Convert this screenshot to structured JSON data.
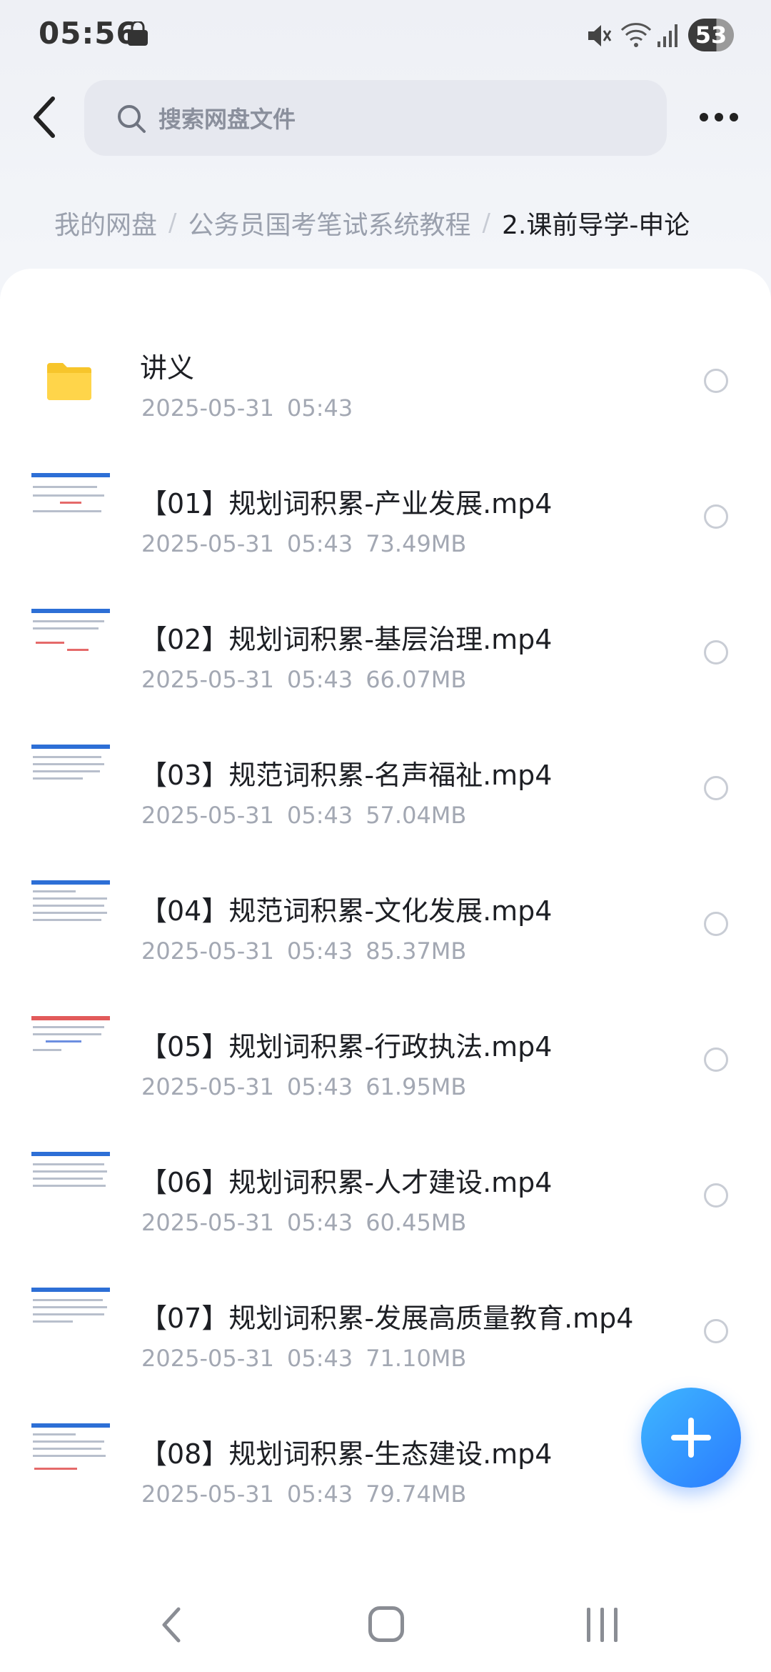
{
  "status_bar": {
    "time": "05:56",
    "battery": "53",
    "icons": [
      "shopping-bag-icon",
      "mute-icon",
      "wifi-icon",
      "signal-icon"
    ]
  },
  "search": {
    "placeholder": "搜索网盘文件"
  },
  "breadcrumb": {
    "items": [
      "我的网盘",
      "公务员国考笔试系统教程",
      "2.课前导学-申论"
    ],
    "separator": "/"
  },
  "files": [
    {
      "name": "讲义",
      "date": "2025-05-31",
      "time": "05:43",
      "size": "",
      "type": "folder"
    },
    {
      "name": "【01】规划词积累-产业发展.mp4",
      "date": "2025-05-31",
      "time": "05:43",
      "size": "73.49MB",
      "type": "video"
    },
    {
      "name": "【02】规划词积累-基层治理.mp4",
      "date": "2025-05-31",
      "time": "05:43",
      "size": "66.07MB",
      "type": "video"
    },
    {
      "name": "【03】规范词积累-名声福祉.mp4",
      "date": "2025-05-31",
      "time": "05:43",
      "size": "57.04MB",
      "type": "video"
    },
    {
      "name": "【04】规范词积累-文化发展.mp4",
      "date": "2025-05-31",
      "time": "05:43",
      "size": "85.37MB",
      "type": "video"
    },
    {
      "name": "【05】规划词积累-行政执法.mp4",
      "date": "2025-05-31",
      "time": "05:43",
      "size": "61.95MB",
      "type": "video"
    },
    {
      "name": "【06】规划词积累-人才建设.mp4",
      "date": "2025-05-31",
      "time": "05:43",
      "size": "60.45MB",
      "type": "video"
    },
    {
      "name": "【07】规划词积累-发展高质量教育.mp4",
      "date": "2025-05-31",
      "time": "05:43",
      "size": "71.10MB",
      "type": "video"
    },
    {
      "name": "【08】规划词积累-生态建设.mp4",
      "date": "2025-05-31",
      "time": "05:43",
      "size": "79.74MB",
      "type": "video"
    }
  ],
  "colors": {
    "accent": "#2a7bff",
    "folder": "#f7c52b",
    "meta_text": "#a3a8b3"
  }
}
